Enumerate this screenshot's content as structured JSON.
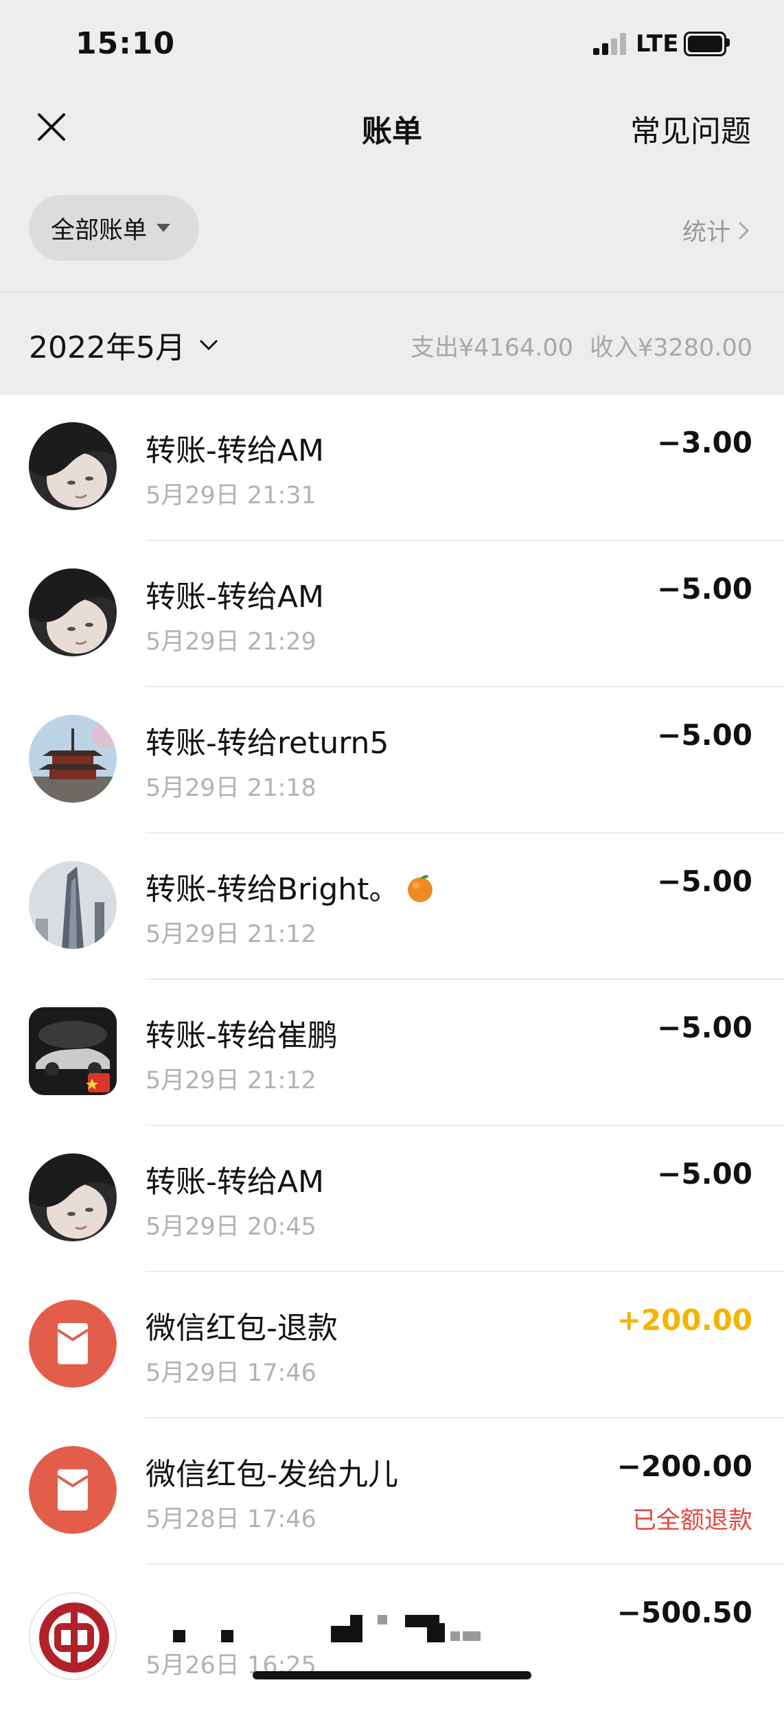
{
  "status_bar": {
    "time": "15:10",
    "network": "LTE"
  },
  "nav": {
    "title": "账单",
    "faq": "常见问题"
  },
  "filter": {
    "label": "全部账单",
    "stats": "统计"
  },
  "summary": {
    "month": "2022年5月",
    "expense": "支出¥4164.00",
    "income": "收入¥3280.00"
  },
  "transactions": [
    {
      "title": "转账-转给AM",
      "date": "5月29日 21:31",
      "amount": "−3.00",
      "avatar": "photo-girl-avatar"
    },
    {
      "title": "转账-转给AM",
      "date": "5月29日 21:29",
      "amount": "−5.00",
      "avatar": "photo-girl-avatar"
    },
    {
      "title": "转账-转给return5",
      "date": "5月29日 21:18",
      "amount": "−5.00",
      "avatar": "pagoda-photo-avatar"
    },
    {
      "title": "转账-转给Bright。",
      "date": "5月29日 21:12",
      "amount": "−5.00",
      "avatar": "skyscraper-photo-avatar",
      "emoji": "orange-icon"
    },
    {
      "title": "转账-转给崔鹏",
      "date": "5月29日 21:12",
      "amount": "−5.00",
      "avatar": "car-photo-avatar"
    },
    {
      "title": "转账-转给AM",
      "date": "5月29日 20:45",
      "amount": "−5.00",
      "avatar": "photo-girl-avatar"
    },
    {
      "title": "微信红包-退款",
      "date": "5月29日 17:46",
      "amount": "+200.00",
      "avatar": "red-packet-icon"
    },
    {
      "title": "微信红包-发给九儿",
      "date": "5月28日 17:46",
      "amount": "−200.00",
      "note": "已全额退款",
      "avatar": "red-packet-icon"
    },
    {
      "title": "",
      "date": "5月26日 16:25",
      "amount": "−500.50",
      "avatar": "bank-of-china-logo"
    }
  ],
  "colors": {
    "background_top": "#ededed",
    "income": "#f4b400",
    "refund_note": "#e5483d",
    "red_packet": "#e35d4b"
  }
}
